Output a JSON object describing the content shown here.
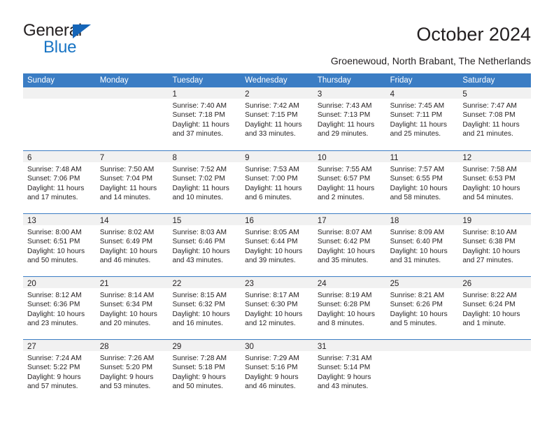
{
  "brand": {
    "name_top": "General",
    "name_bottom": "Blue",
    "color_dark": "#231f20",
    "color_blue": "#1874c4"
  },
  "header": {
    "title": "October 2024",
    "subtitle": "Groenewoud, North Brabant, The Netherlands",
    "accent_color": "#3b7dc4",
    "daybar_color": "#f1f1f1"
  },
  "weekdays": [
    "Sunday",
    "Monday",
    "Tuesday",
    "Wednesday",
    "Thursday",
    "Friday",
    "Saturday"
  ],
  "weeks": [
    [
      {
        "day": "",
        "sunrise": "",
        "sunset": "",
        "daylight_1": "",
        "daylight_2": "",
        "empty": true
      },
      {
        "day": "",
        "sunrise": "",
        "sunset": "",
        "daylight_1": "",
        "daylight_2": "",
        "empty": true
      },
      {
        "day": "1",
        "sunrise": "Sunrise: 7:40 AM",
        "sunset": "Sunset: 7:18 PM",
        "daylight_1": "Daylight: 11 hours",
        "daylight_2": "and 37 minutes."
      },
      {
        "day": "2",
        "sunrise": "Sunrise: 7:42 AM",
        "sunset": "Sunset: 7:15 PM",
        "daylight_1": "Daylight: 11 hours",
        "daylight_2": "and 33 minutes."
      },
      {
        "day": "3",
        "sunrise": "Sunrise: 7:43 AM",
        "sunset": "Sunset: 7:13 PM",
        "daylight_1": "Daylight: 11 hours",
        "daylight_2": "and 29 minutes."
      },
      {
        "day": "4",
        "sunrise": "Sunrise: 7:45 AM",
        "sunset": "Sunset: 7:11 PM",
        "daylight_1": "Daylight: 11 hours",
        "daylight_2": "and 25 minutes."
      },
      {
        "day": "5",
        "sunrise": "Sunrise: 7:47 AM",
        "sunset": "Sunset: 7:08 PM",
        "daylight_1": "Daylight: 11 hours",
        "daylight_2": "and 21 minutes."
      }
    ],
    [
      {
        "day": "6",
        "sunrise": "Sunrise: 7:48 AM",
        "sunset": "Sunset: 7:06 PM",
        "daylight_1": "Daylight: 11 hours",
        "daylight_2": "and 17 minutes."
      },
      {
        "day": "7",
        "sunrise": "Sunrise: 7:50 AM",
        "sunset": "Sunset: 7:04 PM",
        "daylight_1": "Daylight: 11 hours",
        "daylight_2": "and 14 minutes."
      },
      {
        "day": "8",
        "sunrise": "Sunrise: 7:52 AM",
        "sunset": "Sunset: 7:02 PM",
        "daylight_1": "Daylight: 11 hours",
        "daylight_2": "and 10 minutes."
      },
      {
        "day": "9",
        "sunrise": "Sunrise: 7:53 AM",
        "sunset": "Sunset: 7:00 PM",
        "daylight_1": "Daylight: 11 hours",
        "daylight_2": "and 6 minutes."
      },
      {
        "day": "10",
        "sunrise": "Sunrise: 7:55 AM",
        "sunset": "Sunset: 6:57 PM",
        "daylight_1": "Daylight: 11 hours",
        "daylight_2": "and 2 minutes."
      },
      {
        "day": "11",
        "sunrise": "Sunrise: 7:57 AM",
        "sunset": "Sunset: 6:55 PM",
        "daylight_1": "Daylight: 10 hours",
        "daylight_2": "and 58 minutes."
      },
      {
        "day": "12",
        "sunrise": "Sunrise: 7:58 AM",
        "sunset": "Sunset: 6:53 PM",
        "daylight_1": "Daylight: 10 hours",
        "daylight_2": "and 54 minutes."
      }
    ],
    [
      {
        "day": "13",
        "sunrise": "Sunrise: 8:00 AM",
        "sunset": "Sunset: 6:51 PM",
        "daylight_1": "Daylight: 10 hours",
        "daylight_2": "and 50 minutes."
      },
      {
        "day": "14",
        "sunrise": "Sunrise: 8:02 AM",
        "sunset": "Sunset: 6:49 PM",
        "daylight_1": "Daylight: 10 hours",
        "daylight_2": "and 46 minutes."
      },
      {
        "day": "15",
        "sunrise": "Sunrise: 8:03 AM",
        "sunset": "Sunset: 6:46 PM",
        "daylight_1": "Daylight: 10 hours",
        "daylight_2": "and 43 minutes."
      },
      {
        "day": "16",
        "sunrise": "Sunrise: 8:05 AM",
        "sunset": "Sunset: 6:44 PM",
        "daylight_1": "Daylight: 10 hours",
        "daylight_2": "and 39 minutes."
      },
      {
        "day": "17",
        "sunrise": "Sunrise: 8:07 AM",
        "sunset": "Sunset: 6:42 PM",
        "daylight_1": "Daylight: 10 hours",
        "daylight_2": "and 35 minutes."
      },
      {
        "day": "18",
        "sunrise": "Sunrise: 8:09 AM",
        "sunset": "Sunset: 6:40 PM",
        "daylight_1": "Daylight: 10 hours",
        "daylight_2": "and 31 minutes."
      },
      {
        "day": "19",
        "sunrise": "Sunrise: 8:10 AM",
        "sunset": "Sunset: 6:38 PM",
        "daylight_1": "Daylight: 10 hours",
        "daylight_2": "and 27 minutes."
      }
    ],
    [
      {
        "day": "20",
        "sunrise": "Sunrise: 8:12 AM",
        "sunset": "Sunset: 6:36 PM",
        "daylight_1": "Daylight: 10 hours",
        "daylight_2": "and 23 minutes."
      },
      {
        "day": "21",
        "sunrise": "Sunrise: 8:14 AM",
        "sunset": "Sunset: 6:34 PM",
        "daylight_1": "Daylight: 10 hours",
        "daylight_2": "and 20 minutes."
      },
      {
        "day": "22",
        "sunrise": "Sunrise: 8:15 AM",
        "sunset": "Sunset: 6:32 PM",
        "daylight_1": "Daylight: 10 hours",
        "daylight_2": "and 16 minutes."
      },
      {
        "day": "23",
        "sunrise": "Sunrise: 8:17 AM",
        "sunset": "Sunset: 6:30 PM",
        "daylight_1": "Daylight: 10 hours",
        "daylight_2": "and 12 minutes."
      },
      {
        "day": "24",
        "sunrise": "Sunrise: 8:19 AM",
        "sunset": "Sunset: 6:28 PM",
        "daylight_1": "Daylight: 10 hours",
        "daylight_2": "and 8 minutes."
      },
      {
        "day": "25",
        "sunrise": "Sunrise: 8:21 AM",
        "sunset": "Sunset: 6:26 PM",
        "daylight_1": "Daylight: 10 hours",
        "daylight_2": "and 5 minutes."
      },
      {
        "day": "26",
        "sunrise": "Sunrise: 8:22 AM",
        "sunset": "Sunset: 6:24 PM",
        "daylight_1": "Daylight: 10 hours",
        "daylight_2": "and 1 minute."
      }
    ],
    [
      {
        "day": "27",
        "sunrise": "Sunrise: 7:24 AM",
        "sunset": "Sunset: 5:22 PM",
        "daylight_1": "Daylight: 9 hours",
        "daylight_2": "and 57 minutes."
      },
      {
        "day": "28",
        "sunrise": "Sunrise: 7:26 AM",
        "sunset": "Sunset: 5:20 PM",
        "daylight_1": "Daylight: 9 hours",
        "daylight_2": "and 53 minutes."
      },
      {
        "day": "29",
        "sunrise": "Sunrise: 7:28 AM",
        "sunset": "Sunset: 5:18 PM",
        "daylight_1": "Daylight: 9 hours",
        "daylight_2": "and 50 minutes."
      },
      {
        "day": "30",
        "sunrise": "Sunrise: 7:29 AM",
        "sunset": "Sunset: 5:16 PM",
        "daylight_1": "Daylight: 9 hours",
        "daylight_2": "and 46 minutes."
      },
      {
        "day": "31",
        "sunrise": "Sunrise: 7:31 AM",
        "sunset": "Sunset: 5:14 PM",
        "daylight_1": "Daylight: 9 hours",
        "daylight_2": "and 43 minutes."
      },
      {
        "day": "",
        "sunrise": "",
        "sunset": "",
        "daylight_1": "",
        "daylight_2": "",
        "empty": true
      },
      {
        "day": "",
        "sunrise": "",
        "sunset": "",
        "daylight_1": "",
        "daylight_2": "",
        "empty": true
      }
    ]
  ]
}
